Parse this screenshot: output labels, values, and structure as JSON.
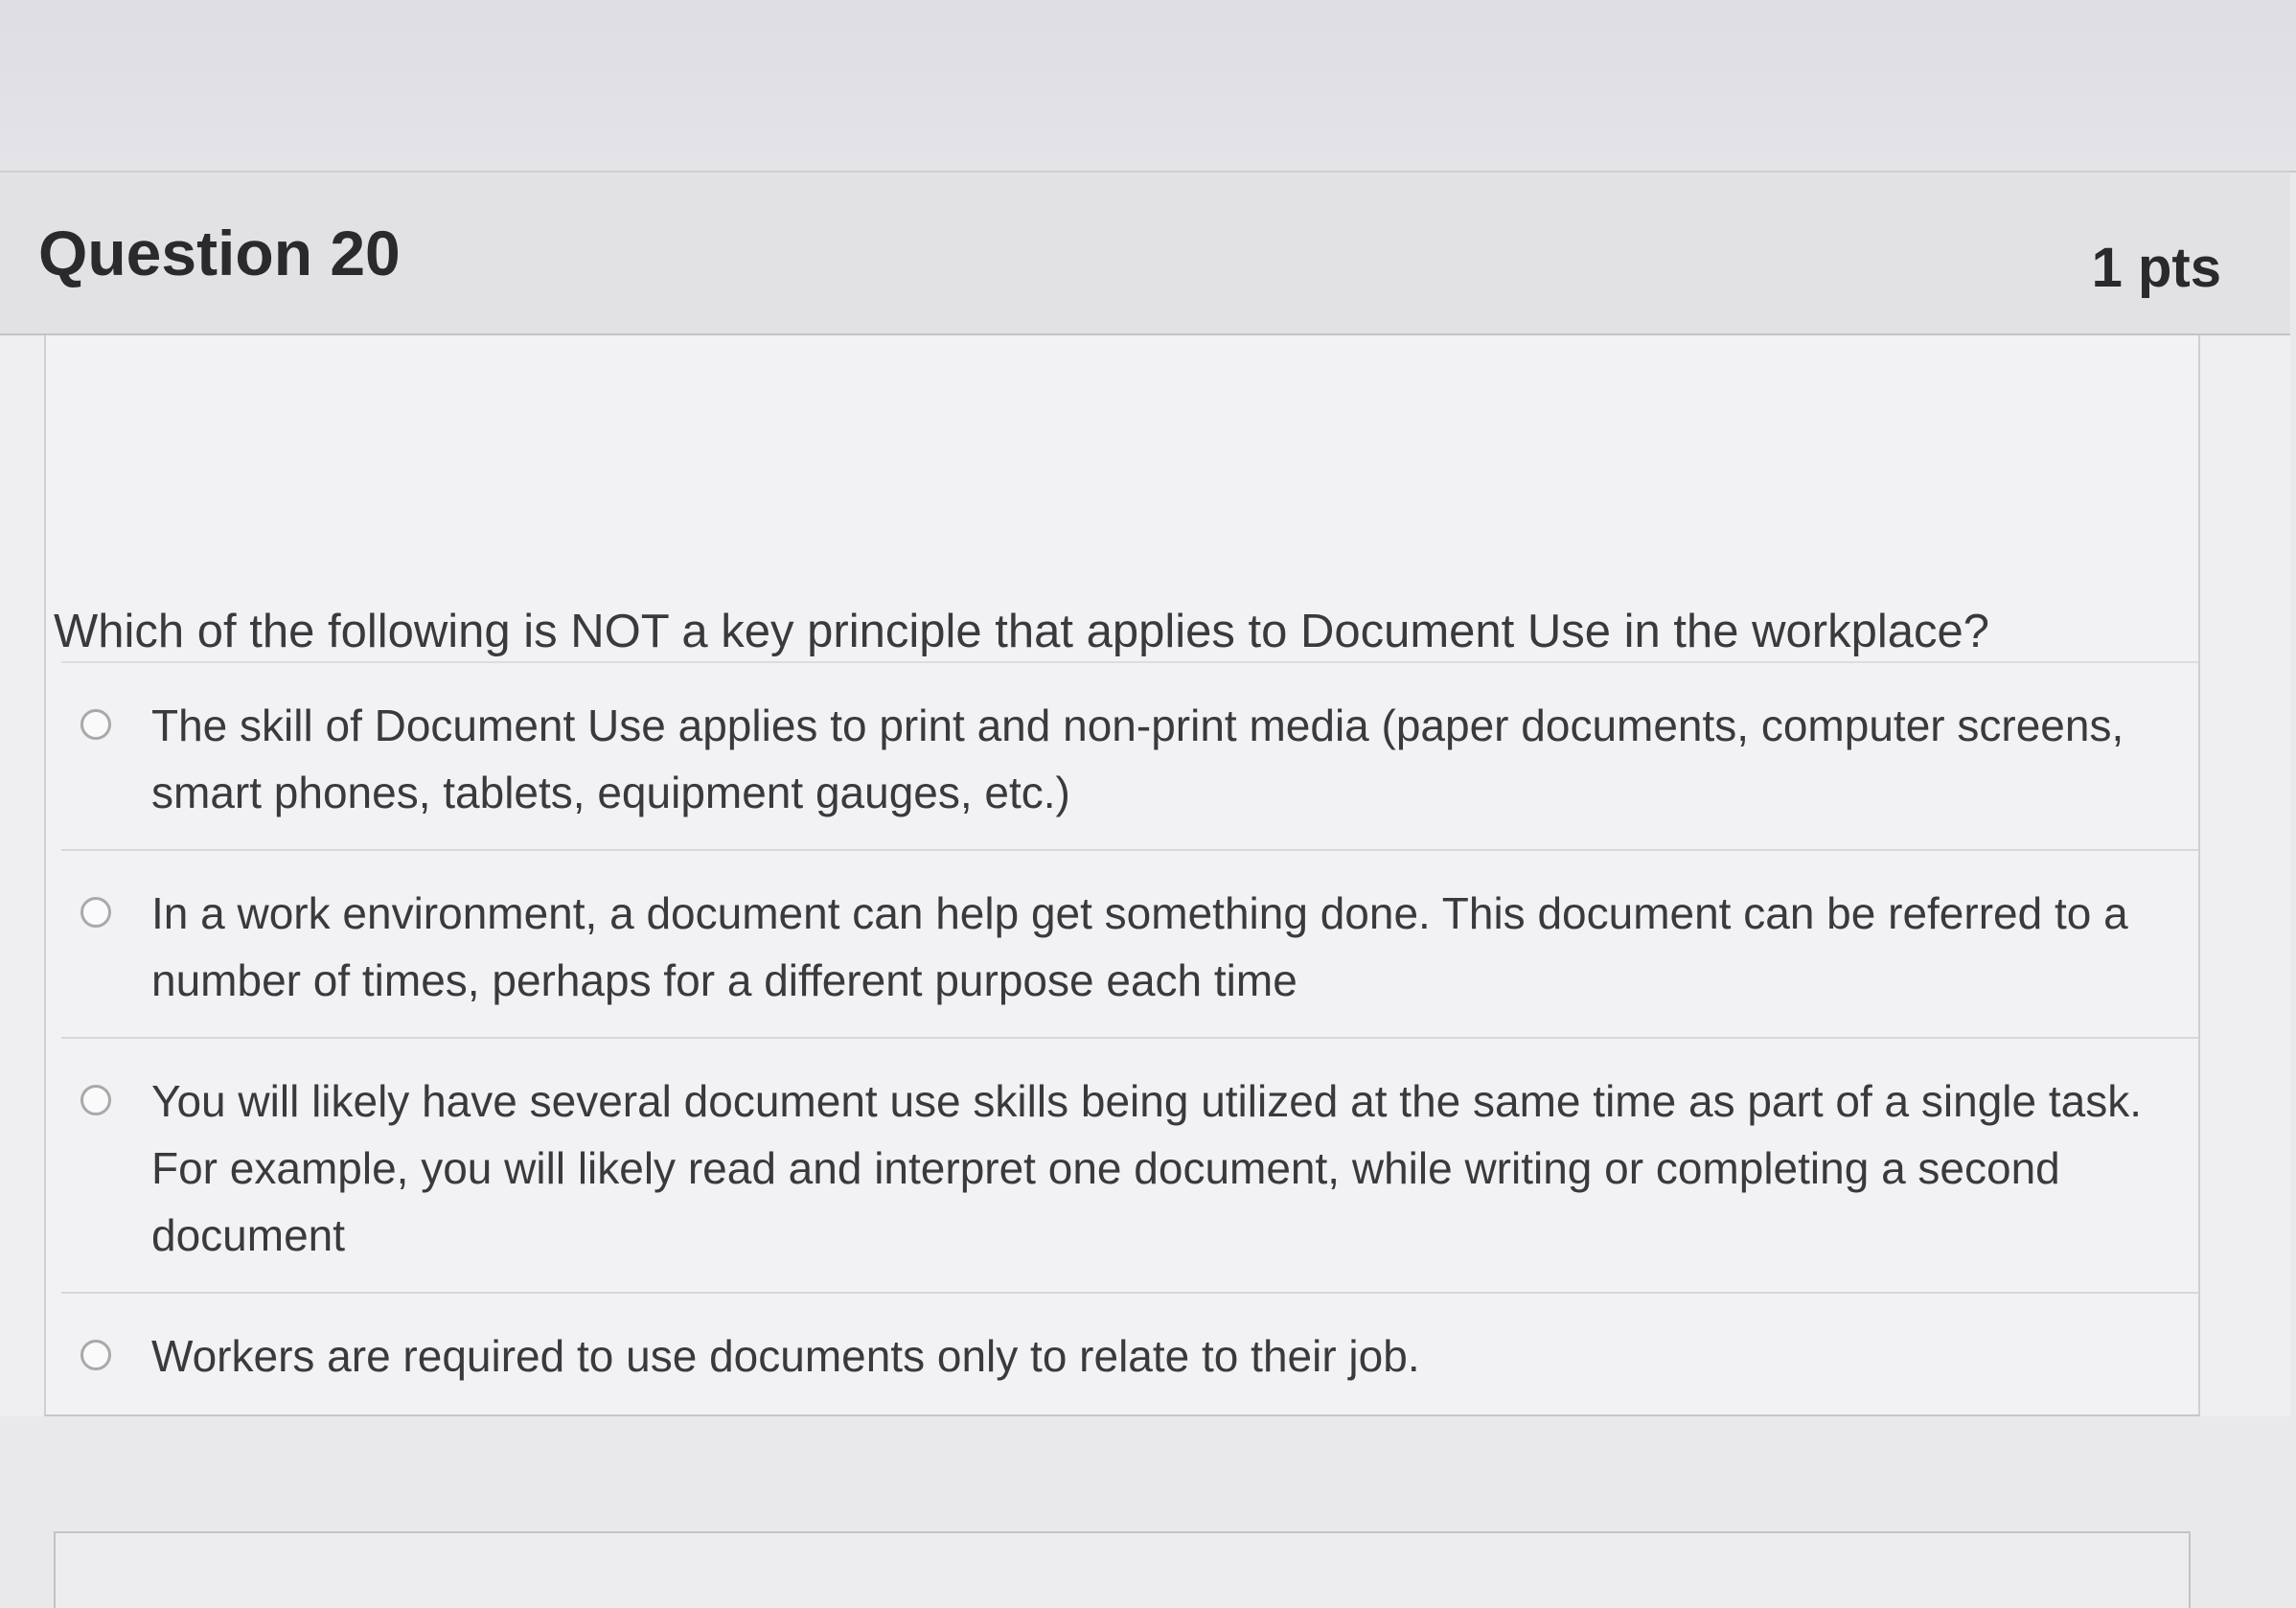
{
  "question": {
    "title": "Question 20",
    "points": "1 pts",
    "text": "Which of the following is NOT a key principle that applies to Document Use in the workplace?",
    "answers": [
      {
        "label": "The skill of Document Use applies to print and non-print media (paper documents, computer screens, smart phones, tablets, equipment gauges, etc.)",
        "selected": false
      },
      {
        "label": "In a work environment, a document can help get something done. This document can be referred to a number of times, perhaps for a different purpose each time",
        "selected": false
      },
      {
        "label": "You will likely have several document use skills being utilized at the same time as part of a single task. For example, you will likely read and interpret one document, while writing or completing a second document",
        "selected": false
      },
      {
        "label": "Workers are required to use documents only to relate to their job.",
        "selected": false
      }
    ]
  }
}
